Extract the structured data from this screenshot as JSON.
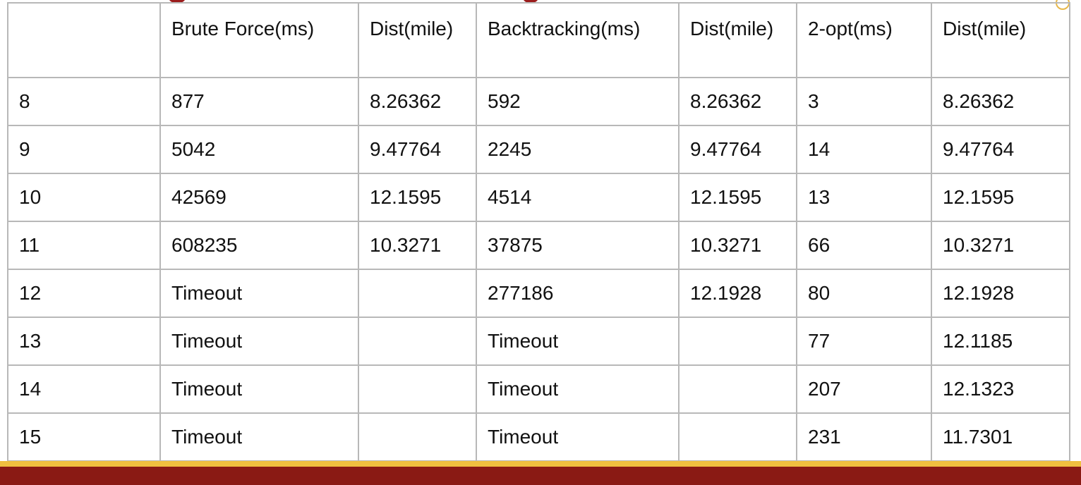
{
  "table": {
    "headers": [
      "",
      "Brute Force(ms)",
      "Dist(mile)",
      "Backtracking(ms)",
      "Dist(mile)",
      "2-opt(ms)",
      "Dist(mile)"
    ],
    "rows": [
      [
        "8",
        "877",
        "8.26362",
        "592",
        "8.26362",
        "3",
        "8.26362"
      ],
      [
        "9",
        "5042",
        "9.47764",
        "2245",
        "9.47764",
        "14",
        "9.47764"
      ],
      [
        "10",
        "42569",
        "12.1595",
        "4514",
        "12.1595",
        "13",
        "12.1595"
      ],
      [
        "11",
        "608235",
        "10.3271",
        "37875",
        "10.3271",
        "66",
        "10.3271"
      ],
      [
        "12",
        "Timeout",
        "",
        "277186",
        "12.1928",
        "80",
        "12.1928"
      ],
      [
        "13",
        "Timeout",
        "",
        "Timeout",
        "",
        "77",
        "12.1185"
      ],
      [
        "14",
        "Timeout",
        "",
        "Timeout",
        "",
        "207",
        "12.1323"
      ],
      [
        "15",
        "Timeout",
        "",
        "Timeout",
        "",
        "231",
        "11.7301"
      ]
    ]
  },
  "theme": {
    "accent_red": "#8a1a14",
    "accent_gold": "#f0c040",
    "grid": "#b8b8b8"
  }
}
